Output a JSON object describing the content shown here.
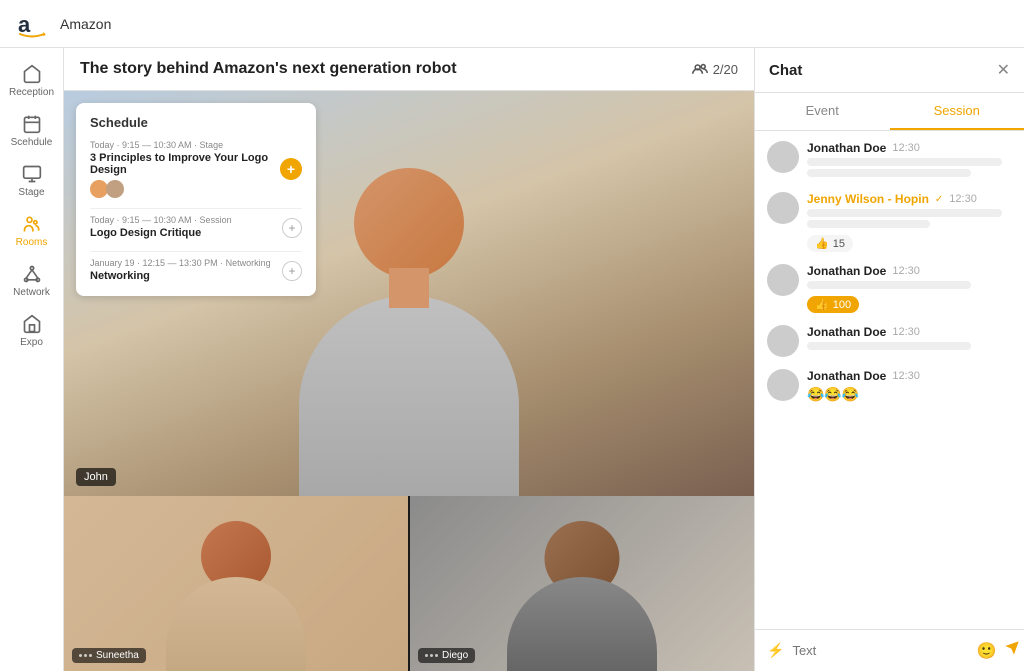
{
  "app": {
    "logo_text": "Amazon",
    "top_bar_title": "Amazon"
  },
  "sidebar": {
    "items": [
      {
        "id": "reception",
        "label": "Reception",
        "active": false
      },
      {
        "id": "schedule",
        "label": "Scehdule",
        "active": false
      },
      {
        "id": "stage",
        "label": "Stage",
        "active": false
      },
      {
        "id": "rooms",
        "label": "Rooms",
        "active": true
      },
      {
        "id": "network",
        "label": "Network",
        "active": false
      },
      {
        "id": "expo",
        "label": "Expo",
        "active": false
      }
    ]
  },
  "header": {
    "title": "The story behind Amazon's next generation robot",
    "attendees": "2/20"
  },
  "schedule": {
    "title": "Schedule",
    "items": [
      {
        "time_label": "Today · 9:15 — 10:30 AM · Stage",
        "name": "3 Principles to Improve Your Logo Design",
        "has_add": true,
        "has_avatars": true
      },
      {
        "time_label": "Today · 9:15 — 10:30 AM · Session",
        "name": "Logo Design Critique",
        "has_add": false,
        "has_avatars": false
      },
      {
        "time_label": "January 19 · 12:15 — 13:30 PM · Networking",
        "name": "Networking",
        "has_add": false,
        "has_avatars": false
      }
    ]
  },
  "videos": {
    "main_name": "John",
    "bottom_left_name": "Suneetha",
    "bottom_right_name": "Diego"
  },
  "chat": {
    "title": "Chat",
    "tabs": [
      "Event",
      "Session"
    ],
    "active_tab": "Session",
    "messages": [
      {
        "name": "Jonathan Doe",
        "time": "12:30",
        "is_hopin": false,
        "lines": [
          "long",
          "medium"
        ],
        "reaction": null,
        "emoji": null
      },
      {
        "name": "Jenny Wilson - Hopin",
        "time": "12:30",
        "is_hopin": true,
        "has_check": true,
        "lines": [
          "long",
          "short"
        ],
        "reaction": {
          "count": "15",
          "orange": false
        },
        "emoji": null
      },
      {
        "name": "Jonathan Doe",
        "time": "12:30",
        "is_hopin": false,
        "lines": [
          "medium"
        ],
        "reaction": {
          "count": "100",
          "orange": true
        },
        "emoji": null
      },
      {
        "name": "Jonathan Doe",
        "time": "12:30",
        "is_hopin": false,
        "lines": [
          "medium"
        ],
        "reaction": null,
        "emoji": null
      },
      {
        "name": "Jonathan Doe",
        "time": "12:30",
        "is_hopin": false,
        "lines": [],
        "reaction": null,
        "emoji": "😂😂😂"
      }
    ],
    "input_placeholder": "Text"
  }
}
